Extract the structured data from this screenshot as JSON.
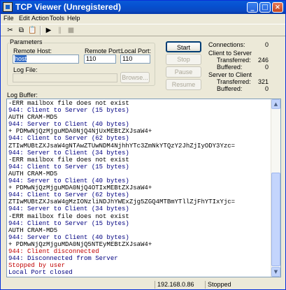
{
  "window": {
    "title": "TCP Viewer (Unregistered)"
  },
  "title_buttons": {
    "minimize": "_",
    "maximize": "□",
    "close": "×"
  },
  "menu": [
    "File",
    "Edit",
    "Action",
    "Tools",
    "Help"
  ],
  "toolbar": {
    "cut": "✂",
    "copy": "⧉",
    "paste": "📋",
    "play": "▶",
    "pause": "‖",
    "stop": "■"
  },
  "parameters": {
    "group_label": "Parameters",
    "remote_host_label": "Remote Host:",
    "remote_host_value": "host",
    "remote_port_label": "Remote Port:",
    "remote_port_value": "110",
    "local_port_label": "Local Port:",
    "local_port_value": "110",
    "log_file_label": "Log File:",
    "log_file_value": "",
    "browse_label": "Browse..."
  },
  "buttons": {
    "start": "Start",
    "stop": "Stop",
    "pause": "Pause",
    "resume": "Resume"
  },
  "stats": {
    "connections_label": "Connections:",
    "connections_value": "0",
    "c2s_label": "Client to Server",
    "c2s_transferred_label": "Transferred:",
    "c2s_transferred_value": "246",
    "c2s_buffered_label": "Buffered:",
    "c2s_buffered_value": "0",
    "s2c_label": "Server to Client",
    "s2c_transferred_label": "Transferred:",
    "s2c_transferred_value": "321",
    "s2c_buffered_label": "Buffered:",
    "s2c_buffered_value": "0"
  },
  "log": {
    "label": "Log Buffer:",
    "lines": [
      {
        "text": "-ERR mailbox file does not exist",
        "color": "black"
      },
      {
        "text": "944: Client to Server (15 bytes)",
        "color": "blue"
      },
      {
        "text": "AUTH CRAM-MD5",
        "color": "black"
      },
      {
        "text": "944: Server to Client (40 bytes)",
        "color": "blue"
      },
      {
        "text": "+ PDMwNjQzMjguMDA0NjQ4NjUxMEBtZXJsaW4+",
        "color": "black"
      },
      {
        "text": "944: Client to Server (62 bytes)",
        "color": "blue"
      },
      {
        "text": "ZTIwMUBtZXJsaW4gNTAwZTUwNDM4NjhhYTc3ZmNkYTQzY2JhZjIyODY3Yzc=",
        "color": "black"
      },
      {
        "text": "944: Server to Client (34 bytes)",
        "color": "blue"
      },
      {
        "text": "-ERR mailbox file does not exist",
        "color": "black"
      },
      {
        "text": "944: Client to Server (15 bytes)",
        "color": "blue"
      },
      {
        "text": "AUTH CRAM-MD5",
        "color": "black"
      },
      {
        "text": "944: Server to Client (40 bytes)",
        "color": "blue"
      },
      {
        "text": "+ PDMwNjQzMjguMDA0NjQ4OTIxMEBtZXJsaW4+",
        "color": "black"
      },
      {
        "text": "944: Client to Server (62 bytes)",
        "color": "blue"
      },
      {
        "text": "ZTIwMUBtZXJsaW4gMzIONzliNDJhYWExZjg5ZGQ4MTBmYTllZjFhYTIxYjc=",
        "color": "black"
      },
      {
        "text": "944: Server to Client (34 bytes)",
        "color": "blue"
      },
      {
        "text": "-ERR mailbox file does not exist",
        "color": "black"
      },
      {
        "text": "944: Client to Server (15 bytes)",
        "color": "blue"
      },
      {
        "text": "AUTH CRAM-MD5",
        "color": "black"
      },
      {
        "text": "944: Server to Client (40 bytes)",
        "color": "blue"
      },
      {
        "text": "+ PDMwNjQzMjguMDA0NjQ5NTEyMEBtZXJsaW4+",
        "color": "black"
      },
      {
        "text": "944: Client disconnected",
        "color": "red"
      },
      {
        "text": "944: Disconnected from Server",
        "color": "blue"
      },
      {
        "text": "Stopped by user",
        "color": "red"
      },
      {
        "text": "Local Port closed",
        "color": "blue"
      }
    ]
  },
  "scrollbar": {
    "up": "▲",
    "down": "▼"
  },
  "status": {
    "ip": "192.168.0.86",
    "state": "Stopped"
  }
}
